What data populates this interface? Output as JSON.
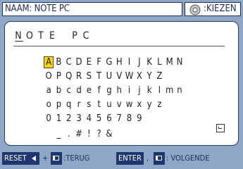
{
  "header": {
    "title": "NAAM: NOTE PC",
    "select_label": ":KIEZEN",
    "select_icon": "gear-disc-icon"
  },
  "name_field": {
    "chars": [
      "N",
      "O",
      "T",
      "E",
      "",
      "P",
      "C"
    ]
  },
  "keyboard": {
    "rows": [
      [
        "A",
        "B",
        "C",
        "D",
        "E",
        "F",
        "G",
        "H",
        "I",
        "J",
        "K",
        "L",
        "M",
        "N"
      ],
      [
        "O",
        "P",
        "Q",
        "R",
        "S",
        "T",
        "U",
        "V",
        "W",
        "X",
        "Y",
        "Z"
      ],
      [
        "a",
        "b",
        "c",
        "d",
        "e",
        "f",
        "g",
        "h",
        "i",
        "j",
        "k",
        "l",
        "m",
        "n"
      ],
      [
        "o",
        "p",
        "q",
        "r",
        "s",
        "t",
        "u",
        "v",
        "w",
        "x",
        "y",
        "z"
      ],
      [
        "0",
        "1",
        "2",
        "3",
        "4",
        "5",
        "6",
        "7",
        "8",
        "9"
      ],
      [
        "",
        "_",
        ".",
        "#",
        "!",
        "?",
        "&"
      ]
    ],
    "selected": "A",
    "enter_icon": "enter-key-icon"
  },
  "footer": {
    "reset": "RESET",
    "plus": "+",
    "terug": ":TERUG",
    "enter": "ENTER",
    "comma": ",",
    "volgende": ": VOLGENDE"
  }
}
